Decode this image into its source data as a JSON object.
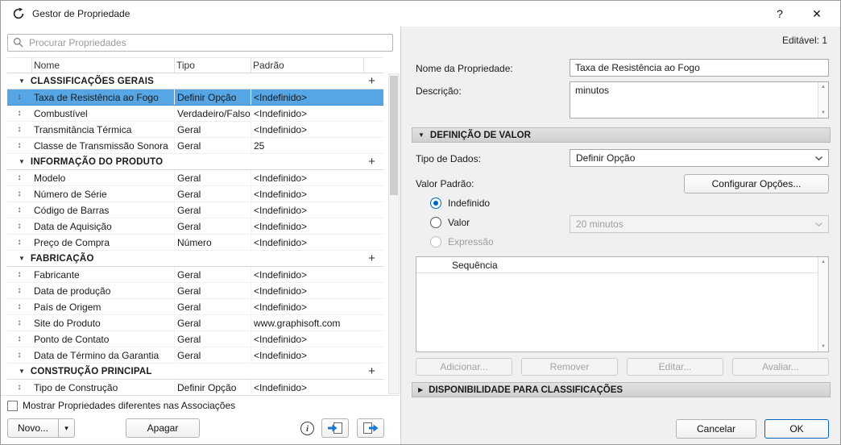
{
  "window": {
    "title": "Gestor de Propriedade",
    "help_label": "?",
    "close_label": "✕"
  },
  "icons": {
    "group_expanded": "▼",
    "section_expanded": "▼",
    "section_collapsed": "▶",
    "add_property": "+",
    "row_handle": "↕",
    "novo_dropdown": "▾",
    "scroll_up": "▲",
    "scroll_down": "▼",
    "info": "i"
  },
  "left_panel": {
    "search": {
      "placeholder": "Procurar Propriedades"
    },
    "table": {
      "columns": [
        "Nome",
        "Tipo",
        "Padrão"
      ],
      "groups": [
        {
          "label": "CLASSIFICAÇÕES GERAIS",
          "rows": [
            {
              "nome": "Taxa de Resistência ao Fogo",
              "tipo": "Definir Opção",
              "padrao": "<Indefinido>",
              "selected": true
            },
            {
              "nome": "Combustível",
              "tipo": "Verdadeiro/Falso",
              "padrao": "<Indefinido>"
            },
            {
              "nome": "Transmitância Térmica",
              "tipo": "Geral",
              "padrao": "<Indefinido>"
            },
            {
              "nome": "Classe de Transmissão Sonora",
              "tipo": "Geral",
              "padrao": "25"
            }
          ]
        },
        {
          "label": "INFORMAÇÃO DO PRODUTO",
          "rows": [
            {
              "nome": "Modelo",
              "tipo": "Geral",
              "padrao": "<Indefinido>"
            },
            {
              "nome": "Número de Série",
              "tipo": "Geral",
              "padrao": "<Indefinido>"
            },
            {
              "nome": "Código de Barras",
              "tipo": "Geral",
              "padrao": "<Indefinido>"
            },
            {
              "nome": "Data de Aquisição",
              "tipo": "Geral",
              "padrao": "<Indefinido>"
            },
            {
              "nome": "Preço de Compra",
              "tipo": "Número",
              "padrao": "<Indefinido>"
            }
          ]
        },
        {
          "label": "FABRICAÇÃO",
          "rows": [
            {
              "nome": "Fabricante",
              "tipo": "Geral",
              "padrao": "<Indefinido>"
            },
            {
              "nome": "Data de produção",
              "tipo": "Geral",
              "padrao": "<Indefinido>"
            },
            {
              "nome": "País de Origem",
              "tipo": "Geral",
              "padrao": "<Indefinido>"
            },
            {
              "nome": "Site do Produto",
              "tipo": "Geral",
              "padrao": "www.graphisoft.com"
            },
            {
              "nome": "Ponto de Contato",
              "tipo": "Geral",
              "padrao": "<Indefinido>"
            },
            {
              "nome": "Data de Término da Garantia",
              "tipo": "Geral",
              "padrao": "<Indefinido>"
            }
          ]
        },
        {
          "label": "CONSTRUÇÃO PRINCIPAL",
          "rows": [
            {
              "nome": "Tipo de Construção",
              "tipo": "Definir Opção",
              "padrao": "<Indefinido>"
            }
          ]
        }
      ]
    },
    "footer": {
      "checkbox_label": "Mostrar Propriedades diferentes nas Associações",
      "novo_label": "Novo...",
      "apagar_label": "Apagar"
    }
  },
  "right_panel": {
    "editable_status": "Editável: 1",
    "name_label": "Nome da Propriedade:",
    "name_value": "Taxa de Resistência ao Fogo",
    "description_label": "Descrição:",
    "description_value": "minutos",
    "value_definition": {
      "header": "DEFINIÇÃO DE VALOR",
      "data_type_label": "Tipo de Dados:",
      "data_type_value": "Definir Opção",
      "default_value_label": "Valor Padrão:",
      "configure_options_label": "Configurar Opções...",
      "radios": [
        {
          "key": "indefinido",
          "label": "Indefinido",
          "checked": true,
          "disabled": false
        },
        {
          "key": "valor",
          "label": "Valor",
          "checked": false,
          "disabled": false
        },
        {
          "key": "expressao",
          "label": "Expressão",
          "checked": false,
          "disabled": true
        }
      ],
      "value_dropdown_value": "20 minutos",
      "list_header": "Sequência",
      "add_label": "Adicionar...",
      "remove_label": "Remover",
      "edit_label": "Editar...",
      "evaluate_label": "Avaliar..."
    },
    "availability_header": "DISPONIBILIDADE PARA CLASSIFICAÇÕES",
    "cancel_label": "Cancelar",
    "ok_label": "OK"
  }
}
